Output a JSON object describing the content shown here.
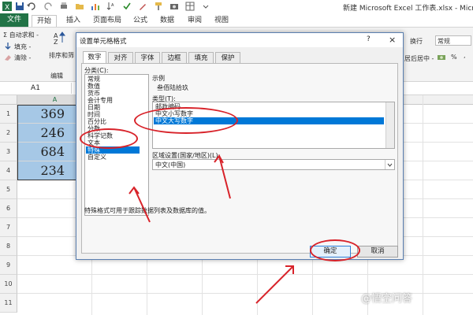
{
  "window": {
    "title": "新建 Microsoft Excel 工作表.xlsx - Microso"
  },
  "ribbon_tabs": {
    "file": "文件",
    "home": "开始",
    "insert": "插入",
    "page_layout": "页面布局",
    "formulas": "公式",
    "data": "数据",
    "review": "审阅",
    "view": "视图"
  },
  "ribbon": {
    "autosum": "Σ 自动求和 -",
    "fill": "填充 -",
    "clear": "清除 -",
    "sort_filter": "排序和筛",
    "editing_group": "编辑",
    "wrap_text": "换行",
    "merge_center": "居后居中 -",
    "number_format": "常规",
    "percent": "%",
    "comma": ","
  },
  "formula_bar": {
    "name_box": "A1"
  },
  "grid": {
    "column_a": "A",
    "rows": [
      "1",
      "2",
      "3",
      "4",
      "5",
      "6",
      "7",
      "8",
      "9",
      "10",
      "11"
    ],
    "cells": [
      "369",
      "246",
      "684",
      "234"
    ]
  },
  "dialog": {
    "title": "设置单元格格式",
    "help": "?",
    "close": "×",
    "tabs": [
      "数字",
      "对齐",
      "字体",
      "边框",
      "填充",
      "保护"
    ],
    "category_label": "分类(C):",
    "categories": [
      "常规",
      "数值",
      "货币",
      "会计专用",
      "日期",
      "时间",
      "百分比",
      "分数",
      "科学记数",
      "文本",
      "特殊",
      "自定义"
    ],
    "selected_category": "特殊",
    "sample_label": "示例",
    "sample_value": "叁佰陆拾玖",
    "type_label": "类型(T):",
    "types": [
      "邮政编码",
      "中文小写数字",
      "中文大写数字"
    ],
    "selected_type": "中文大写数字",
    "locale_label": "区域设置(国家/地区)(L):",
    "locale_value": "中文(中国)",
    "description": "特殊格式可用于跟踪数据列表及数据库的值。",
    "ok": "确定",
    "cancel": "取消"
  },
  "watermark": "@悟空问答",
  "colors": {
    "accent": "#217346",
    "selection": "#0078d7",
    "cell_fill": "#a6c8e6",
    "annotation": "#d8232a"
  }
}
